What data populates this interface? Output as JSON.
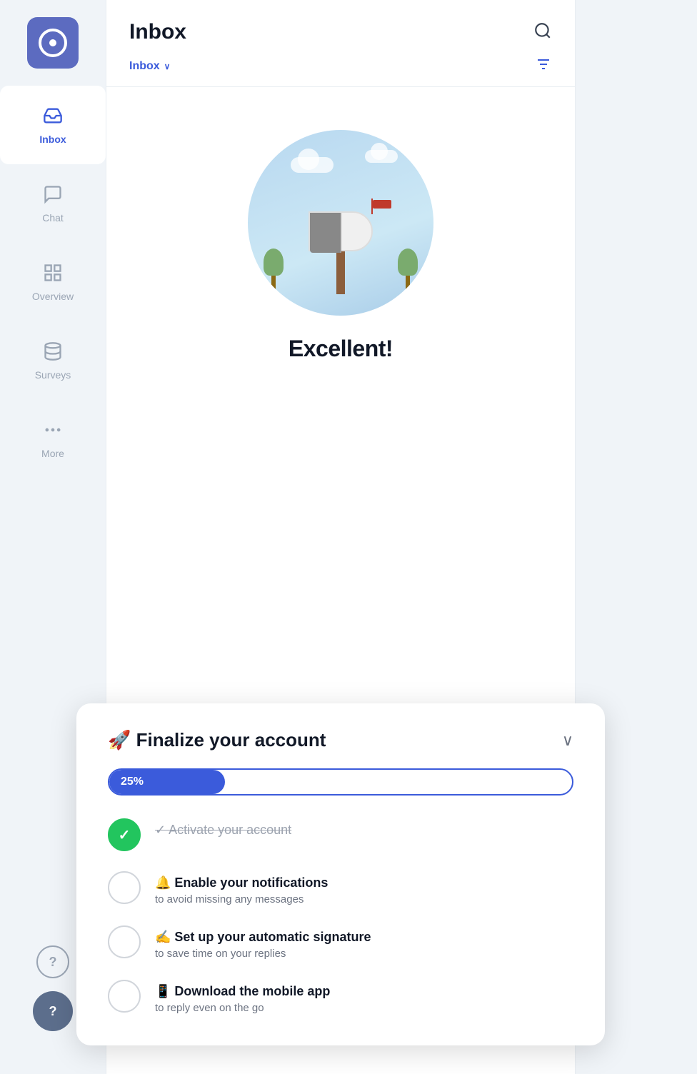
{
  "app": {
    "logo_alt": "App logo"
  },
  "sidebar": {
    "items": [
      {
        "id": "inbox",
        "label": "Inbox",
        "active": true
      },
      {
        "id": "chat",
        "label": "Chat",
        "active": false
      },
      {
        "id": "overview",
        "label": "Overview",
        "active": false
      },
      {
        "id": "surveys",
        "label": "Surveys",
        "active": false
      },
      {
        "id": "more",
        "label": "More",
        "active": false
      }
    ],
    "help_label": "?",
    "support_label": "?"
  },
  "header": {
    "title": "Inbox",
    "dropdown_label": "Inbox",
    "dropdown_caret": "∨"
  },
  "inbox": {
    "illustration_alt": "Empty inbox mailbox",
    "excellent_text": "Excellent!"
  },
  "finalize": {
    "title": "🚀 Finalize your account",
    "collapse_label": "∨",
    "progress_percent": 25,
    "progress_label": "25%",
    "checklist": [
      {
        "id": "activate",
        "done": true,
        "title": "✓ Activate your account",
        "strikethrough": true,
        "subtitle": ""
      },
      {
        "id": "notifications",
        "done": false,
        "title": "🔔 Enable your notifications",
        "strikethrough": false,
        "subtitle": "to avoid missing any messages"
      },
      {
        "id": "signature",
        "done": false,
        "title": "✍️ Set up your automatic signature",
        "strikethrough": false,
        "subtitle": "to save time on your replies"
      },
      {
        "id": "mobile",
        "done": false,
        "title": "📱 Download the mobile app",
        "strikethrough": false,
        "subtitle": "to reply even on the go"
      }
    ]
  }
}
